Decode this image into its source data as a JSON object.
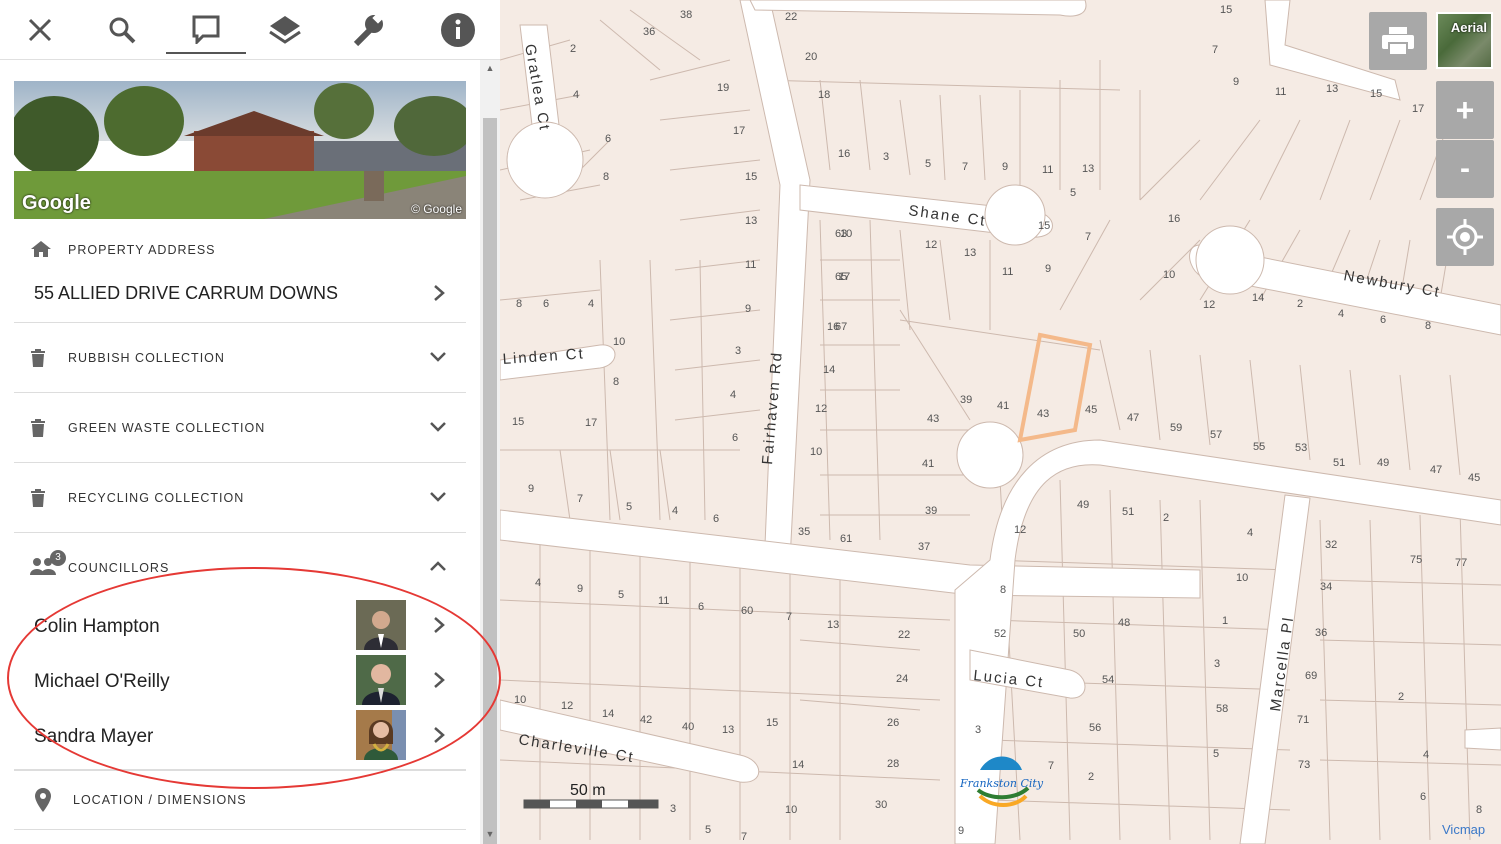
{
  "toolbar": {
    "tools": [
      "close-icon",
      "search-icon",
      "comment-icon",
      "layers-icon",
      "wrench-icon",
      "info-icon"
    ]
  },
  "photo": {
    "logo": "Google",
    "credit": "© Google"
  },
  "property": {
    "heading": "PROPERTY ADDRESS",
    "address": "55 ALLIED DRIVE CARRUM DOWNS"
  },
  "sections": {
    "rubbish": "RUBBISH COLLECTION",
    "green_waste": "GREEN WASTE COLLECTION",
    "recycling": "RECYCLING COLLECTION",
    "councillors": "COUNCILLORS",
    "councillor_count": "3",
    "location": "LOCATION / DIMENSIONS"
  },
  "councillors": [
    {
      "name": "Colin Hampton"
    },
    {
      "name": "Michael O'Reilly"
    },
    {
      "name": "Sandra Mayer"
    }
  ],
  "map": {
    "aerial_label": "Aerial",
    "zoom_in": "+",
    "zoom_out": "-",
    "scale_label": "50 m",
    "attribution": "Vicmap",
    "logo_text": "Frankston City",
    "streets": [
      "Gratlea Ct",
      "Shane Ct",
      "Newbury Ct",
      "Linden Ct",
      "Fairhaven Rd",
      "Lucia Ct",
      "Marcella Pl",
      "Charleville Ct"
    ],
    "lot_numbers": [
      "38",
      "36",
      "2",
      "4",
      "6",
      "8",
      "19",
      "17",
      "15",
      "13",
      "11",
      "9",
      "22",
      "20",
      "18",
      "16",
      "3",
      "5",
      "7",
      "9",
      "11",
      "13",
      "15",
      "7",
      "9",
      "11",
      "13",
      "15",
      "17",
      "16",
      "10",
      "12",
      "14",
      "2",
      "4",
      "6",
      "8",
      "10",
      "12",
      "13",
      "11",
      "9",
      "7",
      "5",
      "15",
      "17",
      "16",
      "14",
      "12",
      "10",
      "8",
      "6",
      "4",
      "10",
      "8",
      "6",
      "4",
      "3",
      "15",
      "17",
      "9",
      "7",
      "5",
      "4",
      "6",
      "39",
      "41",
      "43",
      "45",
      "47",
      "59",
      "57",
      "55",
      "53",
      "51",
      "49",
      "47",
      "45",
      "43",
      "41",
      "39",
      "37",
      "35",
      "61",
      "63",
      "65",
      "67",
      "49",
      "51",
      "2",
      "4",
      "12",
      "10",
      "8",
      "52",
      "50",
      "48",
      "1",
      "54",
      "3",
      "56",
      "58",
      "2",
      "5",
      "3",
      "7",
      "4",
      "9",
      "5",
      "11",
      "6",
      "60",
      "7",
      "13",
      "22",
      "24",
      "26",
      "28",
      "30",
      "32",
      "34",
      "36",
      "69",
      "71",
      "73",
      "75",
      "77",
      "2",
      "4",
      "6",
      "8",
      "10",
      "12",
      "14",
      "42",
      "40",
      "13",
      "15",
      "14",
      "10",
      "3",
      "5",
      "7",
      "9",
      "11",
      "13",
      "15",
      "17",
      "18",
      "12",
      "14",
      "16",
      "64"
    ]
  },
  "colors": {
    "accent_red": "#e53935",
    "parcel_highlight": "#f4b98a",
    "map_bg": "#f5ebe4",
    "road": "#ffffff"
  }
}
